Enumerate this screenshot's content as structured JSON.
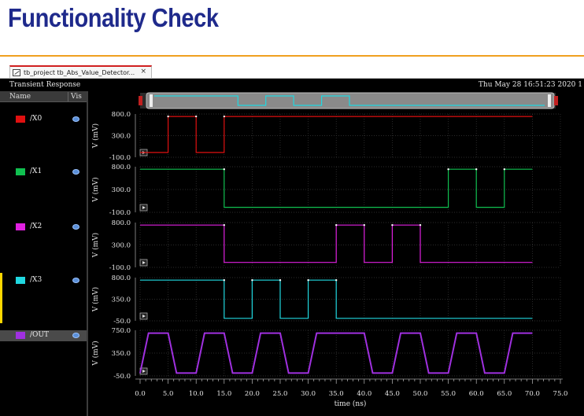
{
  "slide": {
    "title": "Functionality Check"
  },
  "tab": {
    "label": "tb_project tb_Abs_Value_Detector...",
    "close": "×"
  },
  "viewer": {
    "title": "Transient Response",
    "timestamp": "Thu May 28 16:51:23 2020  1"
  },
  "signal_list": {
    "col_name": "Name",
    "col_vis": "Vis",
    "signals": [
      {
        "name": "/X0",
        "color": "#e01010"
      },
      {
        "name": "/X1",
        "color": "#10c050"
      },
      {
        "name": "/X2",
        "color": "#e020e0"
      },
      {
        "name": "/X3",
        "color": "#20d8e0"
      },
      {
        "name": "/OUT",
        "color": "#a030e0"
      }
    ]
  },
  "colors": {
    "background": "#000000",
    "grid": "#3a3a3a",
    "title": "#1f2a8c",
    "accent_rule": "#f0a020"
  },
  "chart_data": {
    "type": "line",
    "xlabel": "time (ns)",
    "xlim": [
      0,
      75
    ],
    "x_ticks": [
      "0.0",
      "5.0",
      "10.0",
      "15.0",
      "20.0",
      "25.0",
      "30.0",
      "35.0",
      "40.0",
      "45.0",
      "50.0",
      "55.0",
      "60.0",
      "65.0",
      "70.0",
      "75.0"
    ],
    "panels": [
      {
        "name": "/X0",
        "ylabel": "V (mV)",
        "yticks": [
          "800.0",
          "300.0",
          "-100.0"
        ],
        "ylim": [
          -100,
          800
        ],
        "color": "#e01010",
        "x": [
          0,
          5,
          5,
          10,
          10,
          15,
          15,
          70
        ],
        "y": [
          0,
          0,
          750,
          750,
          0,
          0,
          750,
          750
        ]
      },
      {
        "name": "/X1",
        "ylabel": "V (mV)",
        "yticks": [
          "800.0",
          "300.0",
          "-100.0"
        ],
        "ylim": [
          -100,
          800
        ],
        "color": "#10c050",
        "x": [
          0,
          15,
          15,
          55,
          55,
          60,
          60,
          65,
          65,
          70
        ],
        "y": [
          750,
          750,
          0,
          0,
          750,
          750,
          0,
          0,
          750,
          750
        ]
      },
      {
        "name": "/X2",
        "ylabel": "V (mV)",
        "yticks": [
          "800.0",
          "300.0",
          "-100.0"
        ],
        "ylim": [
          -100,
          800
        ],
        "color": "#e020e0",
        "x": [
          0,
          15,
          15,
          35,
          35,
          40,
          40,
          45,
          45,
          50,
          50,
          70
        ],
        "y": [
          750,
          750,
          0,
          0,
          750,
          750,
          0,
          0,
          750,
          750,
          0,
          0
        ]
      },
      {
        "name": "/X3",
        "ylabel": "V (mV)",
        "yticks": [
          "800.0",
          "350.0",
          "-50.0"
        ],
        "ylim": [
          -50,
          800
        ],
        "color": "#20d8e0",
        "x": [
          0,
          15,
          15,
          20,
          20,
          25,
          25,
          30,
          30,
          35,
          35,
          70
        ],
        "y": [
          750,
          750,
          0,
          0,
          750,
          750,
          0,
          0,
          750,
          750,
          0,
          0
        ]
      },
      {
        "name": "/OUT",
        "ylabel": "V (mV)",
        "yticks": [
          "750.0",
          "350.0",
          "-50.0"
        ],
        "ylim": [
          -50,
          750
        ],
        "color": "#a030e0",
        "x": [
          0,
          1.5,
          5,
          6.5,
          10,
          11.5,
          15,
          16.5,
          20,
          21.5,
          25,
          26.5,
          30,
          31.5,
          40,
          41.5,
          45,
          46.5,
          50,
          51.5,
          55,
          56.5,
          60,
          61.5,
          65,
          66.5,
          70
        ],
        "y": [
          0,
          700,
          700,
          0,
          0,
          700,
          700,
          0,
          0,
          700,
          700,
          0,
          0,
          700,
          700,
          0,
          0,
          700,
          700,
          0,
          0,
          700,
          700,
          0,
          0,
          700,
          700
        ]
      }
    ],
    "overview": {
      "color": "#20d8e0"
    }
  }
}
